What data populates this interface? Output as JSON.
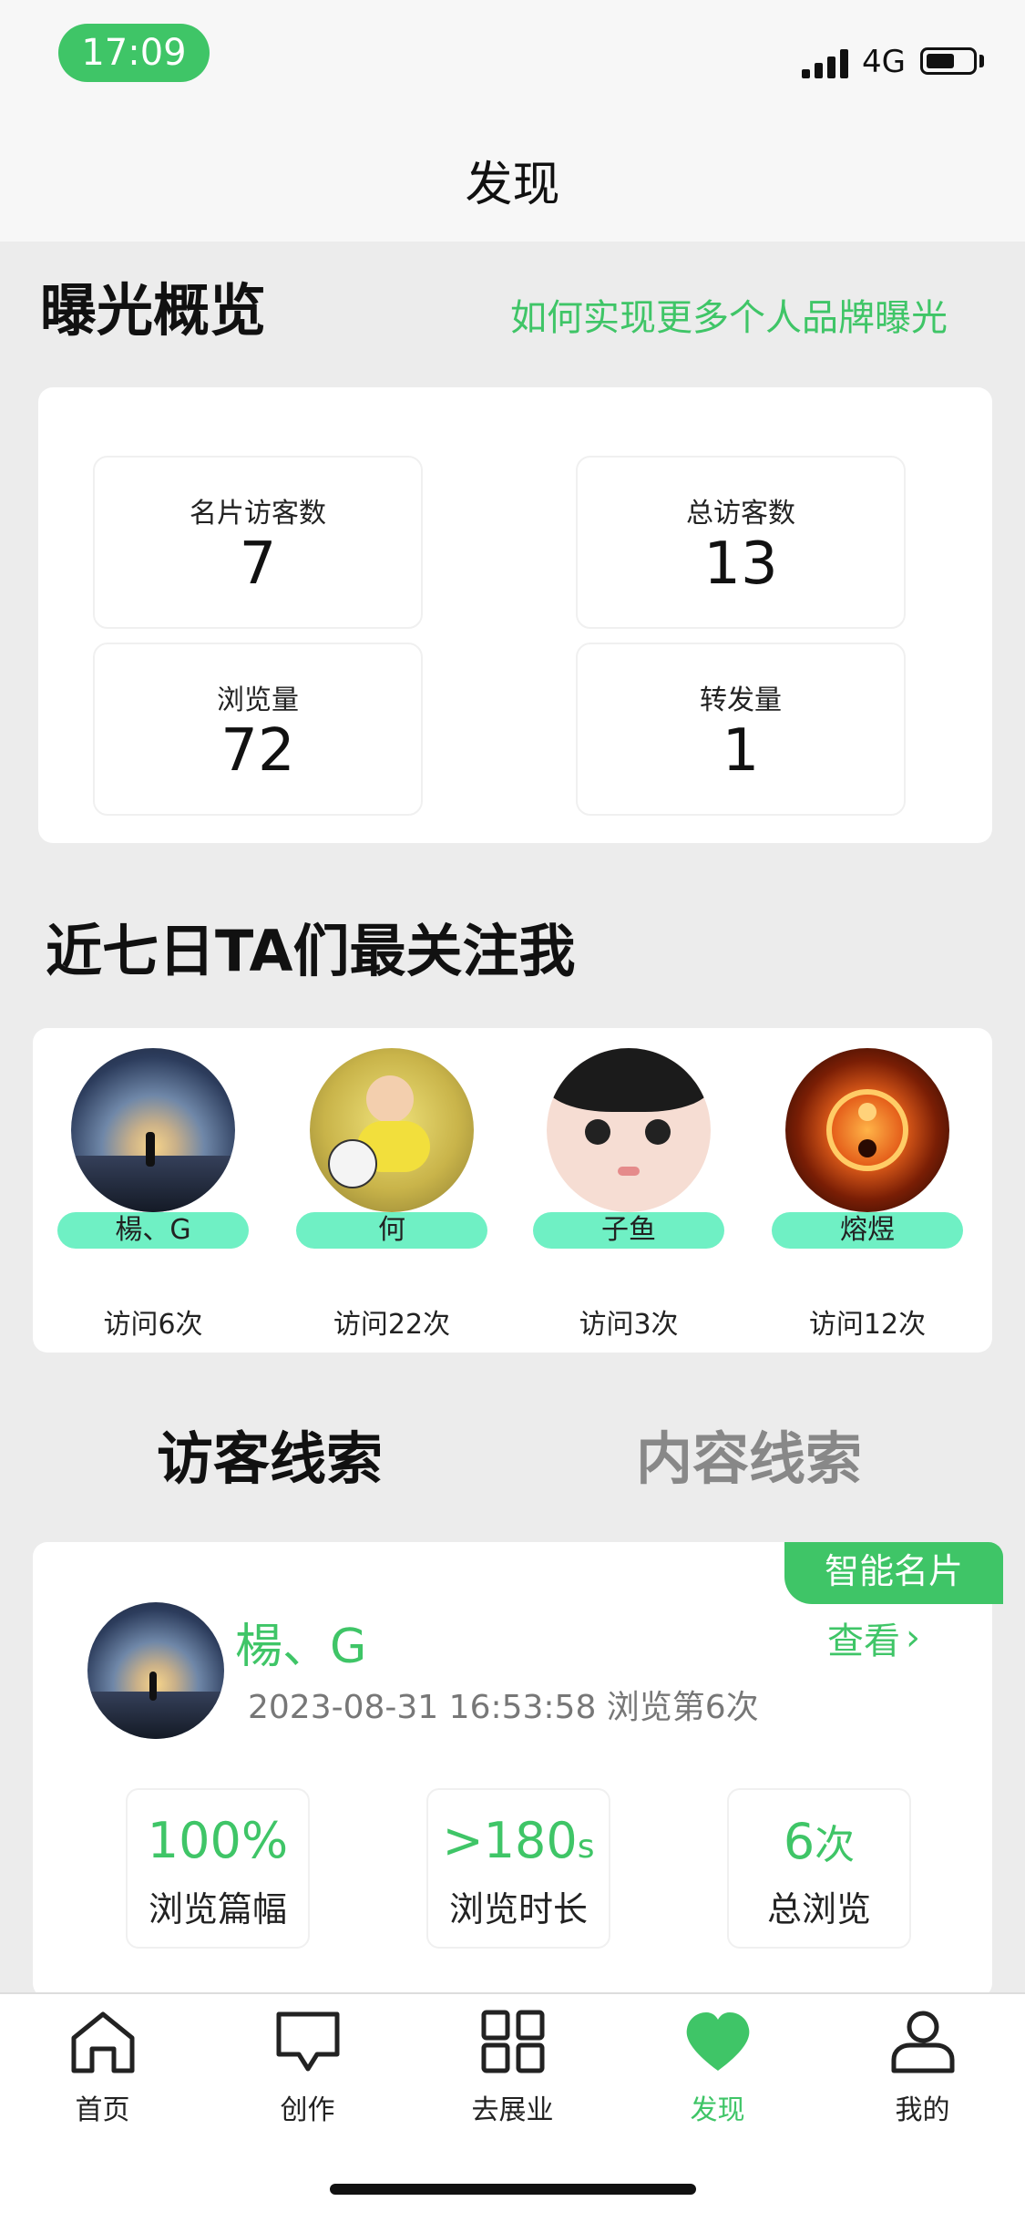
{
  "status": {
    "time": "17:09",
    "network": "4G"
  },
  "header": {
    "title": "发现"
  },
  "exposure": {
    "title": "曝光概览",
    "link": "如何实现更多个人品牌曝光",
    "stats": [
      {
        "label": "名片访客数",
        "value": "7"
      },
      {
        "label": "总访客数",
        "value": "13"
      },
      {
        "label": "浏览量",
        "value": "72"
      },
      {
        "label": "转发量",
        "value": "1"
      }
    ]
  },
  "followers": {
    "title": "近七日TA们最关注我",
    "people": [
      {
        "name": "楊、G",
        "visits": "访问6次"
      },
      {
        "name": "何",
        "visits": "访问22次"
      },
      {
        "name": "子鱼",
        "visits": "访问3次"
      },
      {
        "name": "熔煜",
        "visits": "访问12次"
      }
    ]
  },
  "tabs": {
    "active": "访客线索",
    "inactive": "内容线索"
  },
  "lead": {
    "badge": "智能名片",
    "name": "楊、G",
    "view": "查看",
    "time_info": "2023-08-31 16:53:58  浏览第6次",
    "metrics": [
      {
        "value": "100%",
        "label": "浏览篇幅"
      },
      {
        "value": ">180",
        "unit": "s",
        "label": "浏览时长"
      },
      {
        "value": "6",
        "unit": "次",
        "label": "总浏览"
      }
    ]
  },
  "bottom_nav": [
    {
      "label": "首页",
      "icon": "home-icon"
    },
    {
      "label": "创作",
      "icon": "chat-bubble-icon"
    },
    {
      "label": "去展业",
      "icon": "grid-icon"
    },
    {
      "label": "发现",
      "icon": "heart-icon"
    },
    {
      "label": "我的",
      "icon": "person-icon"
    }
  ],
  "colors": {
    "accent": "#3fc567",
    "pill": "#6ff0c4"
  }
}
